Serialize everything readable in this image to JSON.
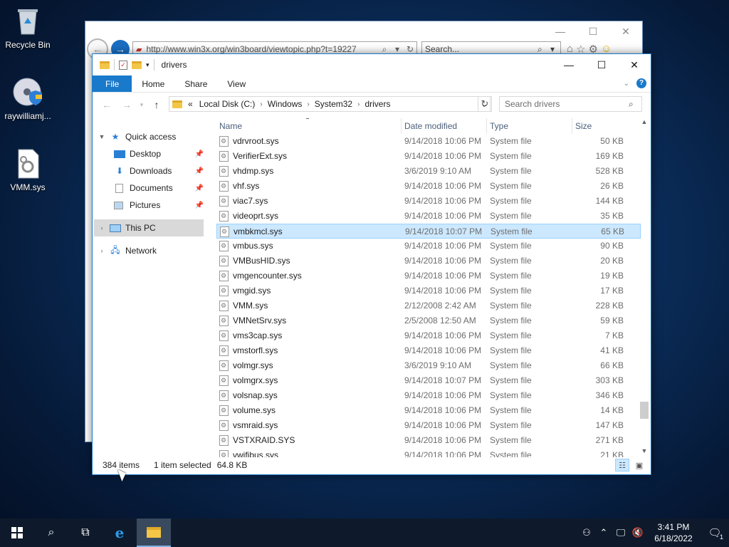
{
  "desktop": {
    "icons": [
      {
        "label": "Recycle Bin",
        "icon": "recycle-bin-icon"
      },
      {
        "label": "raywilliamj...",
        "icon": "disc-shield-icon"
      },
      {
        "label": "VMM.sys",
        "icon": "system-file-icon"
      }
    ]
  },
  "browser": {
    "url": "http://www.win3x.org/win3board/viewtopic.php?t=19227",
    "search_placeholder": "Search..."
  },
  "explorer": {
    "title": "drivers",
    "ribbon_tabs": [
      "File",
      "Home",
      "Share",
      "View"
    ],
    "breadcrumb": [
      "«",
      "Local Disk (C:)",
      "Windows",
      "System32",
      "drivers"
    ],
    "search_placeholder": "Search drivers",
    "nav": {
      "quick_access": "Quick access",
      "items": [
        "Desktop",
        "Downloads",
        "Documents",
        "Pictures"
      ],
      "this_pc": "This PC",
      "network": "Network"
    },
    "columns": {
      "name": "Name",
      "date": "Date modified",
      "type": "Type",
      "size": "Size"
    },
    "files": [
      {
        "name": "vdrvroot.sys",
        "date": "9/14/2018 10:06 PM",
        "type": "System file",
        "size": "50 KB"
      },
      {
        "name": "VerifierExt.sys",
        "date": "9/14/2018 10:06 PM",
        "type": "System file",
        "size": "169 KB"
      },
      {
        "name": "vhdmp.sys",
        "date": "3/6/2019 9:10 AM",
        "type": "System file",
        "size": "528 KB"
      },
      {
        "name": "vhf.sys",
        "date": "9/14/2018 10:06 PM",
        "type": "System file",
        "size": "26 KB"
      },
      {
        "name": "viac7.sys",
        "date": "9/14/2018 10:06 PM",
        "type": "System file",
        "size": "144 KB"
      },
      {
        "name": "videoprt.sys",
        "date": "9/14/2018 10:06 PM",
        "type": "System file",
        "size": "35 KB"
      },
      {
        "name": "vmbkmcl.sys",
        "date": "9/14/2018 10:07 PM",
        "type": "System file",
        "size": "65 KB"
      },
      {
        "name": "vmbus.sys",
        "date": "9/14/2018 10:06 PM",
        "type": "System file",
        "size": "90 KB"
      },
      {
        "name": "VMBusHID.sys",
        "date": "9/14/2018 10:06 PM",
        "type": "System file",
        "size": "20 KB"
      },
      {
        "name": "vmgencounter.sys",
        "date": "9/14/2018 10:06 PM",
        "type": "System file",
        "size": "19 KB"
      },
      {
        "name": "vmgid.sys",
        "date": "9/14/2018 10:06 PM",
        "type": "System file",
        "size": "17 KB"
      },
      {
        "name": "VMM.sys",
        "date": "2/12/2008 2:42 AM",
        "type": "System file",
        "size": "228 KB"
      },
      {
        "name": "VMNetSrv.sys",
        "date": "2/5/2008 12:50 AM",
        "type": "System file",
        "size": "59 KB"
      },
      {
        "name": "vms3cap.sys",
        "date": "9/14/2018 10:06 PM",
        "type": "System file",
        "size": "7 KB"
      },
      {
        "name": "vmstorfl.sys",
        "date": "9/14/2018 10:06 PM",
        "type": "System file",
        "size": "41 KB"
      },
      {
        "name": "volmgr.sys",
        "date": "3/6/2019 9:10 AM",
        "type": "System file",
        "size": "66 KB"
      },
      {
        "name": "volmgrx.sys",
        "date": "9/14/2018 10:07 PM",
        "type": "System file",
        "size": "303 KB"
      },
      {
        "name": "volsnap.sys",
        "date": "9/14/2018 10:06 PM",
        "type": "System file",
        "size": "346 KB"
      },
      {
        "name": "volume.sys",
        "date": "9/14/2018 10:06 PM",
        "type": "System file",
        "size": "14 KB"
      },
      {
        "name": "vsmraid.sys",
        "date": "9/14/2018 10:06 PM",
        "type": "System file",
        "size": "147 KB"
      },
      {
        "name": "VSTXRAID.SYS",
        "date": "9/14/2018 10:06 PM",
        "type": "System file",
        "size": "271 KB"
      },
      {
        "name": "vwifibus.sys",
        "date": "9/14/2018 10:06 PM",
        "type": "System file",
        "size": "21 KB"
      }
    ],
    "selected_file": "vmbkmcl.sys",
    "status": {
      "items": "384 items",
      "selected": "1 item selected",
      "size": "64.8 KB"
    }
  },
  "taskbar": {
    "time": "3:41 PM",
    "date": "6/18/2022",
    "notification_count": "1"
  },
  "colors": {
    "accent": "#1979ca",
    "selection": "#cce8ff"
  }
}
